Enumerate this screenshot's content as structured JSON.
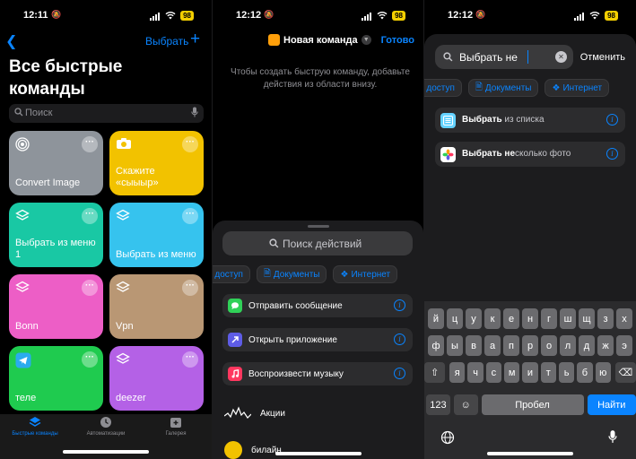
{
  "status": {
    "left_time": "12:11",
    "mid_time": "12:12",
    "right_time": "12:12",
    "battery": "98"
  },
  "left": {
    "back_icon": "chevron-left-icon",
    "select_label": "Выбрать",
    "add_icon": "plus-icon",
    "title": "Все быстрые команды",
    "search_placeholder": "Поиск",
    "tiles": [
      {
        "label": "Convert Image",
        "color": "#8e949b",
        "icon": "target-icon"
      },
      {
        "label": "Скажите «сыыыр»",
        "color": "#f2c200",
        "icon": "camera-icon"
      },
      {
        "label": "Выбрать из меню 1",
        "color": "#19c8a4",
        "icon": "layers-icon"
      },
      {
        "label": "Выбрать из меню",
        "color": "#36c3ee",
        "icon": "layers-icon"
      },
      {
        "label": "Bonn",
        "color": "#ed5ec6",
        "icon": "layers-icon"
      },
      {
        "label": "Vpn",
        "color": "#b99774",
        "icon": "layers-icon"
      },
      {
        "label": "теле",
        "color": "#1fcb4f",
        "icon": "telegram-icon"
      },
      {
        "label": "deezer",
        "color": "#b461e6",
        "icon": "layers-icon"
      }
    ],
    "tabs": [
      {
        "label": "Быстрые команды",
        "active": true
      },
      {
        "label": "Автоматизации",
        "active": false
      },
      {
        "label": "Галерея",
        "active": false
      }
    ]
  },
  "middle": {
    "shortcut_name": "Новая команда",
    "done_label": "Готово",
    "hint": "Чтобы создать быструю команду, добавьте действия из области внизу.",
    "search_placeholder": "Поиск действий",
    "chips": [
      "й доступ",
      "Документы",
      "Интернет"
    ],
    "actions": [
      {
        "label": "Отправить сообщение",
        "color": "#30d158",
        "icon": "message-icon"
      },
      {
        "label": "Открыть приложение",
        "color": "#5e5ce6",
        "icon": "arrow-up-right-icon"
      },
      {
        "label": "Воспроизвести музыку",
        "color": "#ff375f",
        "icon": "music-note-icon"
      }
    ],
    "apps": [
      "Акции",
      "билайн"
    ]
  },
  "right": {
    "search_value": "Выбрать не",
    "cancel_label": "Отменить",
    "chips": [
      "й доступ",
      "Документы",
      "Интернет"
    ],
    "results": [
      {
        "bold": "Выбрать",
        "rest": " из списка",
        "icon": "list-icon",
        "color": "#64d2ff"
      },
      {
        "bold": "Выбрать не",
        "rest": "сколько фото",
        "icon": "photos-icon",
        "color": "#ffffff"
      }
    ],
    "keyboard": {
      "row1": [
        "й",
        "ц",
        "у",
        "к",
        "е",
        "н",
        "г",
        "ш",
        "щ",
        "з",
        "х"
      ],
      "row2": [
        "ф",
        "ы",
        "в",
        "а",
        "п",
        "р",
        "о",
        "л",
        "д",
        "ж",
        "э"
      ],
      "row3": [
        "я",
        "ч",
        "с",
        "м",
        "и",
        "т",
        "ь",
        "б",
        "ю"
      ],
      "num_label": "123",
      "space_label": "Пробел",
      "go_label": "Найти"
    }
  }
}
